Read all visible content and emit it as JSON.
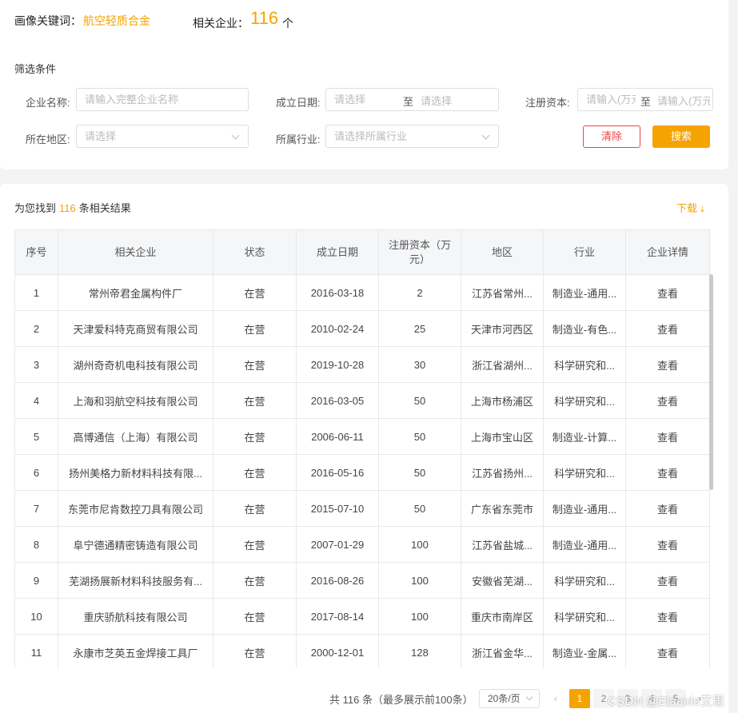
{
  "summary": {
    "keyword_label": "画像关键词：",
    "keyword_value": "航空轻质合金",
    "related_label": "相关企业：",
    "related_count": "116",
    "related_unit": "个"
  },
  "filters": {
    "title": "筛选条件",
    "company_label": "企业名称:",
    "company_placeholder": "请输入完整企业名称",
    "date_label": "成立日期:",
    "date_start_placeholder": "请选择",
    "date_sep": "至",
    "date_end_placeholder": "请选择",
    "capital_label": "注册资本:",
    "capital_min_placeholder": "请输入(万元)",
    "capital_sep": "至",
    "capital_max_placeholder": "请输入(万元)",
    "region_label": "所在地区:",
    "region_placeholder": "请选择",
    "industry_label": "所属行业:",
    "industry_placeholder": "请选择所属行业",
    "clear_label": "清除",
    "search_label": "搜索"
  },
  "results": {
    "found_prefix": "为您找到",
    "found_count": "116",
    "found_suffix": "条相关结果",
    "download_label": "下载",
    "columns": [
      "序号",
      "相关企业",
      "状态",
      "成立日期",
      "注册资本（万元）",
      "地区",
      "行业",
      "企业详情"
    ],
    "rows": [
      {
        "no": "1",
        "company": "常州帝君金属构件厂",
        "status": "在营",
        "date": "2016-03-18",
        "capital": "2",
        "region": "江苏省常州...",
        "industry": "制造业-通用...",
        "detail": "查看"
      },
      {
        "no": "2",
        "company": "天津爱科特克商贸有限公司",
        "status": "在营",
        "date": "2010-02-24",
        "capital": "25",
        "region": "天津市河西区",
        "industry": "制造业-有色...",
        "detail": "查看"
      },
      {
        "no": "3",
        "company": "湖州奇奇机电科技有限公司",
        "status": "在营",
        "date": "2019-10-28",
        "capital": "30",
        "region": "浙江省湖州...",
        "industry": "科学研究和...",
        "detail": "查看"
      },
      {
        "no": "4",
        "company": "上海和羽航空科技有限公司",
        "status": "在营",
        "date": "2016-03-05",
        "capital": "50",
        "region": "上海市杨浦区",
        "industry": "科学研究和...",
        "detail": "查看"
      },
      {
        "no": "5",
        "company": "高博通信（上海）有限公司",
        "status": "在营",
        "date": "2006-06-11",
        "capital": "50",
        "region": "上海市宝山区",
        "industry": "制造业-计算...",
        "detail": "查看"
      },
      {
        "no": "6",
        "company": "扬州美格力新材料科技有限...",
        "status": "在营",
        "date": "2016-05-16",
        "capital": "50",
        "region": "江苏省扬州...",
        "industry": "科学研究和...",
        "detail": "查看"
      },
      {
        "no": "7",
        "company": "东莞市尼肯数控刀具有限公司",
        "status": "在营",
        "date": "2015-07-10",
        "capital": "50",
        "region": "广东省东莞市",
        "industry": "制造业-通用...",
        "detail": "查看"
      },
      {
        "no": "8",
        "company": "阜宁德通精密铸造有限公司",
        "status": "在营",
        "date": "2007-01-29",
        "capital": "100",
        "region": "江苏省盐城...",
        "industry": "制造业-通用...",
        "detail": "查看"
      },
      {
        "no": "9",
        "company": "芜湖扬展新材料科技服务有...",
        "status": "在营",
        "date": "2016-08-26",
        "capital": "100",
        "region": "安徽省芜湖...",
        "industry": "科学研究和...",
        "detail": "查看"
      },
      {
        "no": "10",
        "company": "重庆骄航科技有限公司",
        "status": "在营",
        "date": "2017-08-14",
        "capital": "100",
        "region": "重庆市南岸区",
        "industry": "科学研究和...",
        "detail": "查看"
      },
      {
        "no": "11",
        "company": "永康市芝英五金焊接工具厂",
        "status": "在营",
        "date": "2000-12-01",
        "capital": "128",
        "region": "浙江省金华...",
        "industry": "制造业-金属...",
        "detail": "查看"
      }
    ]
  },
  "pagination": {
    "total_text": "共 116 条（最多展示前100条）",
    "page_size": "20条/页",
    "prev": "‹",
    "pages": [
      "1",
      "2",
      "3",
      "4",
      "5"
    ],
    "next": "›",
    "active_page": "1"
  },
  "watermark": "CSDN @Elaeide艾思",
  "colors": {
    "accent": "#f5a300",
    "danger": "#ee4444",
    "border": "#dcdfe6"
  }
}
